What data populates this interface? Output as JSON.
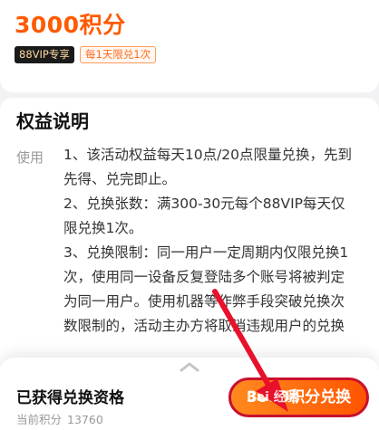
{
  "header": {
    "price": "3000积分",
    "tags": [
      "88VIP专享",
      "每1天限兑1次"
    ]
  },
  "rights": {
    "title": "权益说明",
    "usage_label": "使用",
    "lines": [
      "1、该活动权益每天10点/20点限量兑换，先到",
      "先得、兑完即止。",
      "2、兑换张数：满300-30元每个88VIP每天仅",
      "限兑换1次。",
      "3、兑换限制：同一用户一定周期内仅限兑换1",
      "次，使用同一设备反复登陆多个账号将被判定",
      "为同一用户。使用机器等作弊手段突破兑换次",
      "数限制的，活动主办方将取消违规用户的兑换"
    ]
  },
  "bottom": {
    "status": "已获得兑换资格",
    "points_label": "当前积分",
    "points_value": "13760",
    "button_label": "3000积分兑换"
  },
  "overlay": {
    "watermark": "Bai 经验"
  },
  "colors": {
    "accent": "#ff5a00",
    "annotation": "#c8102e"
  },
  "icons": {
    "handle": "chevron-up-icon",
    "annotation_arrow": "arrow-icon"
  }
}
